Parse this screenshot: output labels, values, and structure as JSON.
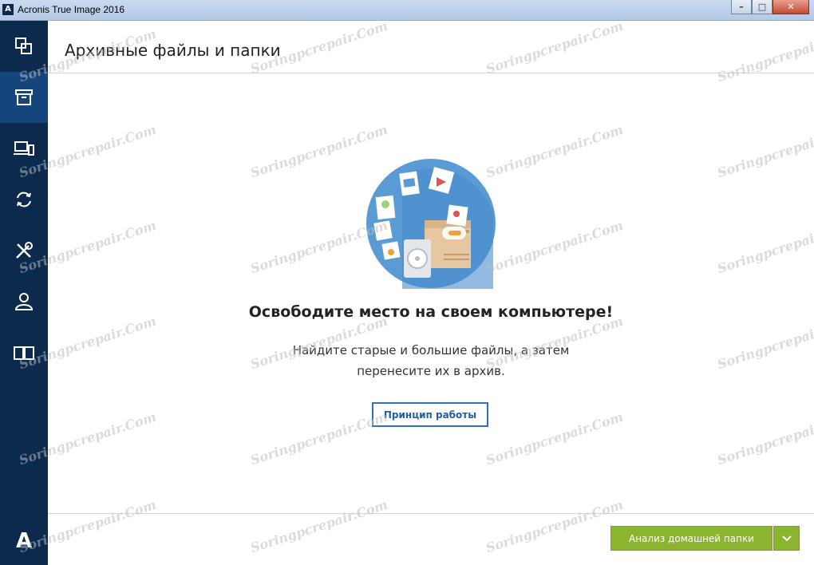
{
  "window": {
    "logo_letter": "A",
    "title": "Acronis True Image 2016",
    "minimize_symbol": "–",
    "maximize_symbol": "□",
    "close_symbol": "✕"
  },
  "sidebar": {
    "items": [
      {
        "name": "backup",
        "icon": "copy-icon",
        "active": false
      },
      {
        "name": "archive",
        "icon": "archive-box-icon",
        "active": true
      },
      {
        "name": "sync",
        "icon": "devices-icon",
        "active": false
      },
      {
        "name": "sync-arrows",
        "icon": "sync-icon",
        "active": false
      },
      {
        "name": "tools",
        "icon": "tools-icon",
        "active": false
      },
      {
        "name": "account",
        "icon": "user-icon",
        "active": false
      },
      {
        "name": "help",
        "icon": "book-icon",
        "active": false
      }
    ],
    "logo": "A"
  },
  "header": {
    "title": "Архивные файлы и папки"
  },
  "main": {
    "headline": "Освободите место на своем компьютере!",
    "description_line1": "Найдите старые и большие файлы, а затем",
    "description_line2": "перенесите их в архив.",
    "howto_button": "Принцип работы"
  },
  "footer": {
    "analyze_button": "Анализ домашней папки",
    "dropdown_icon": "chevron-down-icon"
  },
  "watermark_text": "Soringpcrepair.Com",
  "colors": {
    "sidebar_bg": "#0b2a4e",
    "sidebar_active": "#15457d",
    "accent_blue": "#3072b8",
    "green_button": "#8bb52f"
  }
}
